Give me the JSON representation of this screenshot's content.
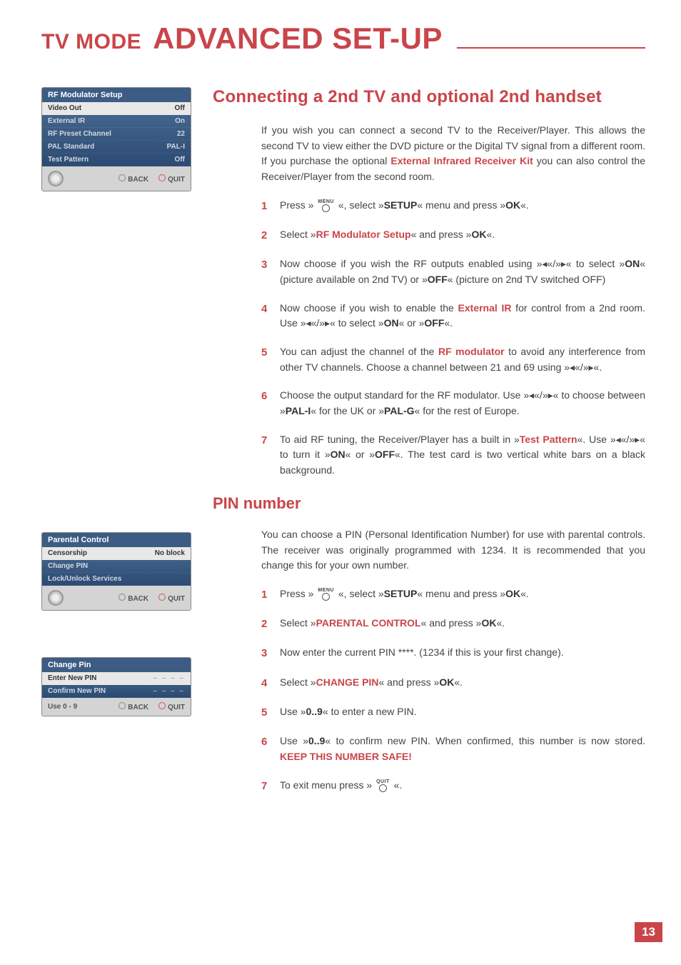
{
  "header": {
    "tv_mode": "TV MODE",
    "title": "ADVANCED SET-UP"
  },
  "section1": {
    "title": "Connecting a 2nd TV and optional 2nd handset",
    "intro_a": "If you wish you can connect a second TV to the Receiver/Player. This allows the second TV to view either the DVD picture or the Digital TV signal from a different room. If you purchase the optional ",
    "intro_kw": "External Infrared Receiver Kit",
    "intro_b": " you can also control the Receiver/Player from the second room.",
    "steps": [
      {
        "n": "1",
        "pre": "Press » ",
        "icon": "MENU",
        "mid": " «, select »",
        "kw1": "SETUP",
        "post1": "« menu and press »",
        "kw2": "OK",
        "post2": "«."
      },
      {
        "n": "2",
        "pre": "Select »",
        "kw1": "RF Modulator Setup",
        "post1": "« and press »",
        "kw2": "OK",
        "post2": "«."
      },
      {
        "n": "3",
        "text": "Now choose if you wish the RF outputs enabled using »◂«/»▸« to select »",
        "kw1": "ON",
        "mid1": "« (picture available on 2nd TV) or »",
        "kw2": "OFF",
        "post2": "« (picture on 2nd TV switched OFF)"
      },
      {
        "n": "4",
        "pre": "Now choose if you wish to enable the ",
        "kwred": "External IR",
        "mid": " for control from a 2nd room. Use »◂«/»▸« to select »",
        "kw1": "ON",
        "mid1": "« or »",
        "kw2": "OFF",
        "post2": "«."
      },
      {
        "n": "5",
        "pre": "You can adjust the channel of the ",
        "kwred": "RF modulator",
        "post": " to avoid any interference from other TV channels. Choose a channel between 21 and 69 using »◂«/»▸«."
      },
      {
        "n": "6",
        "pre": "Choose the output standard for the RF modulator. Use »◂«/»▸« to choose between »",
        "kw1": "PAL-I",
        "mid1": "« for the UK or »",
        "kw2": "PAL-G",
        "post2": "« for the rest of Europe."
      },
      {
        "n": "7",
        "pre": "To aid RF tuning, the Receiver/Player has a built in »",
        "kwred": "Test Pattern",
        "mid": "«. Use »◂«/»▸« to turn it »",
        "kw1": "ON",
        "mid1": "« or »",
        "kw2": "OFF",
        "post2": "«. The test card is two vertical white bars on a black background."
      }
    ]
  },
  "section2": {
    "title": "PIN number",
    "intro": "You can choose a PIN (Personal Identification Number) for use with parental controls. The receiver was originally programmed with 1234. It is recommended that you change this for your own number.",
    "steps": [
      {
        "n": "1",
        "pre": "Press » ",
        "icon": "MENU",
        "mid": " «, select »",
        "kw1": "SETUP",
        "post1": "« menu and press »",
        "kw2": "OK",
        "post2": "«."
      },
      {
        "n": "2",
        "pre": "Select »",
        "kw1": "PARENTAL CONTROL",
        "post1": "« and press »",
        "kw2": "OK",
        "post2": "«."
      },
      {
        "n": "3",
        "text": "Now enter the current PIN ****. (1234 if this is your first change)."
      },
      {
        "n": "4",
        "pre": "Select »",
        "kw1": "CHANGE PIN",
        "post1": "« and press »",
        "kw2": "OK",
        "post2": "«."
      },
      {
        "n": "5",
        "pre": "Use »",
        "kw1": "0..9",
        "post1": "« to enter a new PIN."
      },
      {
        "n": "6",
        "pre": "Use »",
        "kw1": "0..9",
        "post1": "« to confirm new PIN. When confirmed, this number is now stored. ",
        "kwred": "KEEP THIS NUMBER SAFE!"
      },
      {
        "n": "7",
        "pre": "To exit menu press » ",
        "icon": "QUIT",
        "post1": " «."
      }
    ]
  },
  "osd1": {
    "title": "RF Modulator Setup",
    "rows": [
      {
        "l": "Video Out",
        "r": "Off",
        "sel": true
      },
      {
        "l": "External IR",
        "r": "On"
      },
      {
        "l": "RF Preset Channel",
        "r": "22"
      },
      {
        "l": "PAL Standard",
        "r": "PAL-I"
      },
      {
        "l": "Test Pattern",
        "r": "Off"
      }
    ],
    "foot": {
      "back": "BACK",
      "quit": "QUIT"
    }
  },
  "osd2": {
    "title": "Parental Control",
    "rows": [
      {
        "l": "Censorship",
        "r": "No block",
        "sel": true
      },
      {
        "l": "Change PIN",
        "r": ""
      },
      {
        "l": "Lock/Unlock Services",
        "r": ""
      }
    ],
    "foot": {
      "back": "BACK",
      "quit": "QUIT"
    }
  },
  "osd3": {
    "title": "Change Pin",
    "rows": [
      {
        "l": "Enter New PIN",
        "r": "– – – –",
        "sel": true
      },
      {
        "l": "Confirm New PIN",
        "r": "– – – –"
      }
    ],
    "foot": {
      "left": "Use 0 - 9",
      "back": "BACK",
      "quit": "QUIT"
    }
  },
  "page_num": "13"
}
